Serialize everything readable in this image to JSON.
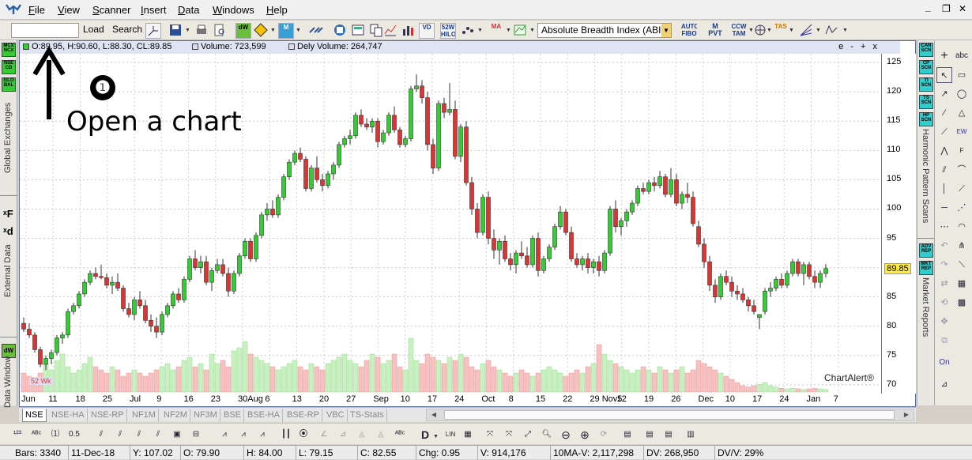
{
  "menu": {
    "items": [
      "File",
      "View",
      "Scanner",
      "Insert",
      "Data",
      "Windows",
      "Help"
    ],
    "win_minimize": "_",
    "win_restore": "❐",
    "win_close": "✕"
  },
  "toolbar1": {
    "symbol_value": "",
    "load_label": "Load",
    "search_label": "Search",
    "icons": [
      "52W HILO",
      "AUTO FIBO",
      "M PVT",
      "CCW TAM",
      "TAS"
    ],
    "indicator_select": "Absolute Breadth Index (ABI"
  },
  "left_panel": {
    "icons": [
      "MCX NCX",
      "NSE CD",
      "GLO BAL"
    ],
    "global_exchanges": "Global Exchanges",
    "external_data": "External Data",
    "data_window": "Data Window",
    "dw_label": "dW",
    "xf_label": "ˣF",
    "xd_label": "ˣd"
  },
  "chart": {
    "info": {
      "ohlc": "O:89.95, H:90.60, L:88.30, CL:89.85",
      "volume": "Volume: 723,599",
      "dely_volume": "Dely Volume: 264,747"
    },
    "window_controls": "e - + x",
    "last_price": "89.85",
    "watermark": "ChartAlert®",
    "hilo_label": "52 Wk",
    "y_ticks": [
      "125",
      "120",
      "115",
      "110",
      "105",
      "100",
      "95",
      "90",
      "85",
      "80",
      "75",
      "70"
    ],
    "x_ticks": [
      "Jun",
      "11",
      "18",
      "25",
      "Jul",
      "9",
      "16",
      "23",
      "30Aug",
      "6",
      "13",
      "20",
      "27",
      "Sep",
      "10",
      "17",
      "24",
      "Oct",
      "8",
      "15",
      "22",
      "29 Nov5",
      "12",
      "19",
      "26",
      "Dec",
      "10",
      "17",
      "24",
      "Jan",
      "7"
    ]
  },
  "chart_data": {
    "type": "candlestick",
    "ylim": [
      68.5,
      126.5
    ],
    "up_color": "#33cc33",
    "down_color": "#dd3333",
    "volume_up_color": "#c8f0c0",
    "volume_down_color": "#f8c0c0",
    "candles": [
      [
        80.5,
        81.5,
        79.0,
        79.5
      ],
      [
        79.5,
        80.5,
        78.0,
        78.5
      ],
      [
        78.5,
        79.0,
        75.5,
        76.0
      ],
      [
        76.0,
        76.5,
        73.0,
        73.5
      ],
      [
        73.5,
        75.0,
        72.5,
        74.5
      ],
      [
        74.5,
        76.0,
        73.5,
        75.5
      ],
      [
        75.5,
        78.5,
        75.0,
        78.0
      ],
      [
        78.0,
        79.0,
        77.0,
        78.5
      ],
      [
        78.5,
        83.0,
        78.0,
        82.5
      ],
      [
        82.5,
        84.0,
        82.0,
        83.5
      ],
      [
        83.5,
        86.0,
        83.0,
        85.5
      ],
      [
        85.5,
        88.0,
        85.0,
        87.5
      ],
      [
        87.5,
        89.5,
        87.0,
        89.0
      ],
      [
        89.0,
        90.0,
        88.0,
        88.5
      ],
      [
        88.5,
        90.5,
        88.0,
        88.3
      ],
      [
        88.3,
        89.0,
        86.5,
        87.0
      ],
      [
        87.0,
        88.5,
        85.5,
        87.5
      ],
      [
        87.5,
        89.0,
        86.0,
        86.5
      ],
      [
        86.5,
        87.0,
        82.5,
        83.0
      ],
      [
        83.0,
        84.0,
        81.5,
        82.0
      ],
      [
        82.0,
        85.0,
        81.0,
        84.5
      ],
      [
        84.5,
        86.0,
        83.0,
        83.5
      ],
      [
        83.5,
        84.5,
        80.5,
        81.0
      ],
      [
        81.0,
        82.0,
        79.0,
        80.0
      ],
      [
        80.0,
        81.5,
        78.0,
        79.0
      ],
      [
        79.0,
        82.5,
        78.5,
        82.0
      ],
      [
        82.0,
        84.0,
        81.5,
        83.5
      ],
      [
        83.5,
        86.0,
        83.0,
        85.5
      ],
      [
        85.5,
        86.5,
        84.0,
        84.5
      ],
      [
        84.5,
        88.5,
        84.0,
        88.0
      ],
      [
        88.0,
        92.0,
        87.5,
        91.5
      ],
      [
        91.5,
        93.0,
        89.5,
        90.0
      ],
      [
        90.0,
        92.0,
        89.0,
        91.0
      ],
      [
        91.0,
        92.0,
        87.0,
        87.5
      ],
      [
        87.5,
        90.0,
        86.0,
        89.5
      ],
      [
        89.5,
        91.5,
        89.0,
        90.5
      ],
      [
        90.5,
        91.5,
        88.5,
        89.0
      ],
      [
        89.0,
        90.0,
        85.0,
        86.0
      ],
      [
        86.0,
        89.5,
        85.5,
        89.0
      ],
      [
        89.0,
        92.5,
        88.5,
        92.0
      ],
      [
        92.0,
        95.0,
        91.5,
        94.5
      ],
      [
        94.5,
        95.0,
        91.0,
        91.5
      ],
      [
        91.5,
        96.0,
        91.0,
        95.5
      ],
      [
        95.5,
        99.5,
        95.0,
        99.0
      ],
      [
        99.0,
        101.0,
        98.0,
        100.0
      ],
      [
        100.0,
        101.5,
        98.5,
        99.0
      ],
      [
        99.0,
        102.5,
        98.5,
        102.0
      ],
      [
        102.0,
        106.0,
        101.5,
        105.5
      ],
      [
        105.5,
        108.5,
        105.0,
        108.0
      ],
      [
        108.0,
        110.0,
        107.5,
        109.5
      ],
      [
        109.5,
        110.5,
        108.0,
        108.5
      ],
      [
        108.5,
        109.0,
        103.0,
        103.5
      ],
      [
        103.5,
        107.5,
        103.0,
        107.0
      ],
      [
        107.0,
        109.0,
        104.5,
        105.0
      ],
      [
        105.0,
        106.0,
        103.0,
        104.0
      ],
      [
        104.0,
        106.5,
        103.5,
        106.0
      ],
      [
        106.0,
        108.0,
        105.0,
        107.5
      ],
      [
        107.5,
        111.5,
        107.0,
        111.0
      ],
      [
        111.0,
        112.5,
        110.5,
        112.0
      ],
      [
        112.0,
        113.5,
        111.0,
        112.5
      ],
      [
        112.5,
        116.5,
        112.0,
        116.0
      ],
      [
        116.0,
        117.0,
        114.0,
        114.5
      ],
      [
        114.5,
        115.5,
        113.5,
        114.0
      ],
      [
        114.0,
        115.5,
        113.0,
        115.0
      ],
      [
        115.0,
        115.5,
        110.5,
        111.5
      ],
      [
        111.5,
        113.5,
        111.0,
        113.0
      ],
      [
        113.0,
        116.5,
        112.5,
        116.0
      ],
      [
        116.0,
        117.5,
        113.0,
        113.5
      ],
      [
        113.5,
        114.0,
        110.5,
        111.0
      ],
      [
        111.0,
        112.5,
        110.5,
        112.0
      ],
      [
        112.0,
        121.0,
        111.5,
        120.5
      ],
      [
        120.5,
        123.0,
        120.0,
        121.0
      ],
      [
        121.0,
        122.0,
        118.0,
        119.0
      ],
      [
        119.0,
        120.0,
        110.0,
        111.0
      ],
      [
        111.0,
        112.0,
        106.0,
        107.0
      ],
      [
        107.0,
        118.5,
        106.5,
        118.0
      ],
      [
        118.0,
        119.0,
        115.5,
        116.5
      ],
      [
        116.5,
        121.5,
        116.0,
        117.0
      ],
      [
        117.0,
        118.5,
        108.5,
        109.0
      ],
      [
        109.0,
        114.5,
        108.0,
        114.0
      ],
      [
        114.0,
        115.0,
        104.0,
        104.5
      ],
      [
        104.5,
        105.5,
        99.0,
        100.0
      ],
      [
        100.0,
        101.0,
        95.0,
        96.0
      ],
      [
        96.0,
        102.5,
        95.5,
        102.0
      ],
      [
        102.0,
        103.0,
        94.0,
        95.0
      ],
      [
        95.0,
        96.5,
        91.5,
        93.0
      ],
      [
        93.0,
        95.0,
        90.5,
        94.5
      ],
      [
        94.5,
        95.5,
        91.0,
        91.5
      ],
      [
        91.5,
        92.5,
        89.5,
        90.5
      ],
      [
        90.5,
        93.0,
        89.0,
        92.5
      ],
      [
        92.5,
        94.5,
        91.5,
        92.0
      ],
      [
        92.0,
        93.5,
        90.0,
        90.5
      ],
      [
        90.5,
        95.5,
        90.0,
        95.0
      ],
      [
        95.0,
        96.0,
        88.5,
        89.5
      ],
      [
        89.5,
        92.0,
        89.0,
        91.5
      ],
      [
        91.5,
        94.0,
        91.0,
        93.5
      ],
      [
        93.5,
        97.5,
        93.0,
        97.0
      ],
      [
        97.0,
        100.5,
        96.5,
        99.5
      ],
      [
        99.5,
        100.0,
        95.5,
        96.0
      ],
      [
        96.0,
        97.0,
        91.0,
        91.5
      ],
      [
        91.5,
        92.5,
        90.0,
        90.5
      ],
      [
        90.5,
        92.0,
        89.5,
        91.5
      ],
      [
        91.5,
        92.5,
        89.0,
        90.0
      ],
      [
        90.0,
        91.5,
        89.0,
        91.0
      ],
      [
        91.0,
        92.0,
        88.5,
        89.5
      ],
      [
        89.5,
        93.0,
        89.0,
        92.5
      ],
      [
        92.5,
        100.5,
        92.0,
        100.0
      ],
      [
        100.0,
        101.5,
        96.0,
        97.0
      ],
      [
        97.0,
        98.5,
        95.5,
        98.0
      ],
      [
        98.0,
        100.0,
        97.0,
        99.5
      ],
      [
        99.5,
        101.5,
        99.0,
        101.0
      ],
      [
        101.0,
        104.0,
        100.5,
        103.5
      ],
      [
        103.5,
        104.5,
        102.5,
        103.0
      ],
      [
        103.0,
        105.0,
        102.5,
        104.5
      ],
      [
        104.5,
        105.5,
        103.0,
        104.0
      ],
      [
        104.0,
        106.5,
        103.5,
        105.5
      ],
      [
        105.5,
        106.0,
        102.0,
        102.5
      ],
      [
        102.5,
        107.0,
        102.0,
        105.0
      ],
      [
        105.0,
        106.0,
        100.5,
        101.0
      ],
      [
        101.0,
        103.0,
        100.0,
        102.5
      ],
      [
        102.5,
        104.5,
        101.0,
        102.0
      ],
      [
        102.0,
        103.0,
        97.0,
        97.5
      ],
      [
        97.0,
        98.0,
        93.5,
        94.0
      ],
      [
        94.0,
        95.0,
        90.0,
        91.0
      ],
      [
        91.0,
        92.0,
        86.0,
        87.0
      ],
      [
        87.0,
        88.0,
        84.0,
        85.0
      ],
      [
        85.0,
        89.0,
        84.5,
        88.5
      ],
      [
        88.5,
        89.5,
        87.0,
        87.5
      ],
      [
        87.5,
        88.5,
        85.0,
        86.0
      ],
      [
        86.0,
        87.0,
        84.5,
        85.5
      ],
      [
        85.5,
        86.5,
        84.0,
        84.5
      ],
      [
        84.5,
        85.0,
        82.5,
        83.5
      ],
      [
        83.5,
        84.5,
        82.0,
        82.5
      ],
      [
        81.5,
        82.0,
        79.5,
        82.0
      ],
      [
        82.5,
        86.5,
        82.0,
        86.0
      ],
      [
        86.0,
        87.5,
        85.0,
        86.5
      ],
      [
        86.5,
        88.5,
        86.0,
        88.0
      ],
      [
        88.0,
        89.0,
        86.5,
        87.0
      ],
      [
        87.0,
        89.5,
        86.5,
        89.0
      ],
      [
        89.0,
        91.5,
        88.5,
        91.0
      ],
      [
        91.0,
        91.5,
        88.5,
        89.0
      ],
      [
        89.0,
        91.0,
        87.0,
        90.5
      ],
      [
        90.5,
        91.0,
        88.0,
        88.5
      ],
      [
        88.5,
        89.5,
        86.5,
        87.5
      ],
      [
        87.5,
        89.5,
        86.5,
        89.0
      ],
      [
        89.0,
        90.6,
        88.3,
        89.85
      ]
    ],
    "volumes": [
      0.3,
      0.25,
      0.2,
      0.3,
      0.45,
      0.35,
      0.5,
      0.6,
      0.4,
      0.3,
      0.35,
      0.45,
      0.55,
      0.4,
      0.35,
      0.3,
      0.4,
      0.35,
      0.25,
      0.3,
      0.35,
      0.3,
      0.25,
      0.3,
      0.35,
      0.4,
      0.45,
      0.35,
      0.4,
      0.5,
      0.55,
      0.4,
      0.45,
      0.35,
      0.6,
      0.45,
      0.5,
      0.4,
      0.65,
      0.7,
      0.8,
      0.6,
      0.55,
      0.5,
      0.45,
      0.4,
      0.35,
      0.4,
      0.45,
      0.5,
      0.4,
      0.35,
      0.45,
      0.4,
      0.35,
      0.45,
      0.5,
      0.55,
      0.6,
      0.5,
      0.45,
      0.4,
      0.5,
      0.6,
      0.55,
      0.45,
      0.5,
      0.6,
      0.4,
      0.35,
      0.85,
      0.5,
      0.45,
      0.6,
      0.55,
      0.5,
      0.45,
      0.55,
      0.5,
      0.6,
      0.55,
      0.4,
      0.35,
      0.45,
      0.5,
      0.4,
      0.35,
      0.3,
      0.25,
      0.3,
      0.35,
      0.3,
      0.25,
      0.3,
      0.35,
      0.4,
      0.35,
      0.3,
      0.25,
      0.3,
      0.35,
      0.3,
      0.4,
      0.45,
      0.75,
      0.6,
      0.5,
      0.45,
      0.4,
      0.35,
      0.3,
      0.35,
      0.4,
      0.35,
      0.3,
      0.4,
      0.35,
      0.3,
      0.35,
      0.4,
      0.3,
      0.35,
      0.5,
      0.45,
      0.4,
      0.35,
      0.3,
      0.25,
      0.2,
      0.15,
      0.1,
      0.08,
      0.1,
      0.12,
      0.15,
      0.1,
      0.08,
      0.06,
      0.05,
      0.06,
      0.05,
      0.04,
      0.05,
      0.06,
      0.05,
      0.04
    ]
  },
  "annotation": {
    "step_number": "❶",
    "text": "Open a chart"
  },
  "tabs": [
    "NSE",
    "NSE-HA",
    "NSE-RP",
    "NF1M",
    "NF2M",
    "NF3M",
    "BSE",
    "BSE-HA",
    "BSE-RP",
    "VBC",
    "TS-Stats"
  ],
  "right_scans": {
    "icons": [
      "CAN SCN",
      "CP SCN",
      "TI SCN",
      "TS SCN",
      "HP SCN",
      "ADV REP",
      "MKT REP"
    ],
    "harmonic_label": "Harmonic Pattern Scans",
    "market_reports_label": "Market Reports"
  },
  "draw_tools": {
    "abc": "abc",
    "on": "On"
  },
  "statusbar": {
    "bars": "Bars: 3340",
    "date": "11-Dec-18",
    "high": "H: 84.00",
    "yv": "Y: 107.02",
    "open": "O: 79.90",
    "low": "L: 79.15",
    "close": "C: 82.55",
    "chg": "Chg: 0.95",
    "vol": "V: 914,176",
    "mav": "10MA-V: 2,117,298",
    "dv": "DV: 268,950",
    "dvv": "DV/V: 29%"
  }
}
